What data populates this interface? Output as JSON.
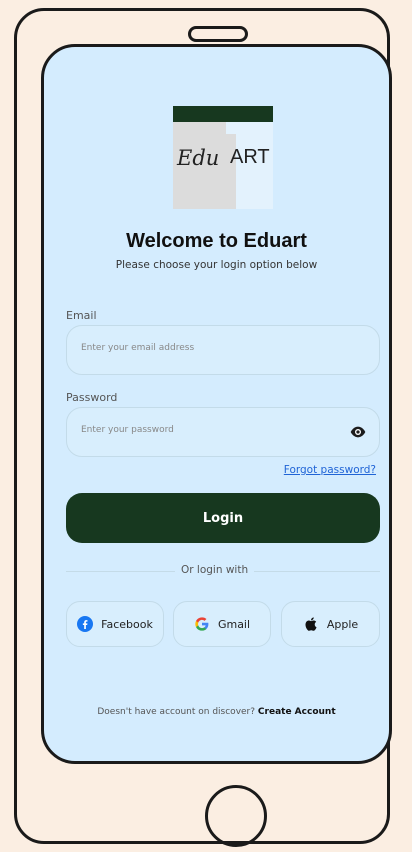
{
  "logo": {
    "script_text": "Edu",
    "art_text": "ART"
  },
  "header": {
    "title": "Welcome to Eduart",
    "subtitle": "Please choose your login option below"
  },
  "form": {
    "email_label": "Email",
    "email_placeholder": "Enter your email address",
    "password_label": "Password",
    "password_placeholder": "Enter your password",
    "forgot_link": "Forgot password?",
    "login_button": "Login"
  },
  "social": {
    "divider_text": "Or login with",
    "facebook": "Facebook",
    "gmail": "Gmail",
    "apple": "Apple"
  },
  "footer": {
    "prompt": "Doesn't have account on discover?",
    "create_link": "Create Account"
  },
  "colors": {
    "accent": "#17381f",
    "screen_bg": "#d4ecfe",
    "page_bg": "#fbeee2",
    "link": "#2064d6"
  }
}
